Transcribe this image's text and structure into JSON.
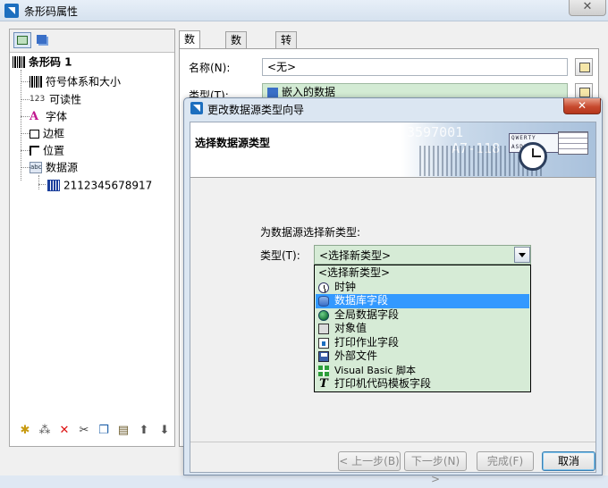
{
  "outer_window": {
    "title": "条形码属性",
    "close_glyph": "✕"
  },
  "tree": {
    "root_label": "条形码 1",
    "items": [
      {
        "label": "符号体系和大小",
        "icon": "barcode-icon"
      },
      {
        "label": "可读性",
        "icon": "readability-123-icon",
        "icon_text": "123"
      },
      {
        "label": "字体",
        "icon": "font-icon",
        "icon_text": "A"
      },
      {
        "label": "边框",
        "icon": "border-icon"
      },
      {
        "label": "位置",
        "icon": "position-icon"
      },
      {
        "label": "数据源",
        "icon": "datasource-icon",
        "icon_text": "abc"
      }
    ],
    "child_label": "2112345678917"
  },
  "bottom_toolbar": {
    "icons": [
      "new-icon",
      "wand-icon",
      "delete-icon",
      "cut-icon",
      "copy-icon",
      "paste-icon",
      "move-up-icon",
      "move-down-icon"
    ]
  },
  "tabs": [
    "数据源",
    "数据类型",
    "转换"
  ],
  "form": {
    "name_label": "名称(N):",
    "name_value": "<无>",
    "type_label": "类型(T):",
    "type_value": "嵌入的数据"
  },
  "wizard": {
    "title": "更改数据源类型向导",
    "close_glyph": "✕",
    "header_title": "选择数据源类型",
    "banner_numbers": [
      "3597001",
      "A7-118"
    ],
    "prompt": "为数据源选择新类型:",
    "type_label": "类型(T):",
    "combo_value": "<选择新类型>",
    "options": [
      {
        "label": "<选择新类型>",
        "icon": ""
      },
      {
        "label": "时钟",
        "icon": "clock-icon"
      },
      {
        "label": "数据库字段",
        "icon": "database-icon",
        "selected": true
      },
      {
        "label": "全局数据字段",
        "icon": "globe-icon"
      },
      {
        "label": "对象值",
        "icon": "object-value-icon"
      },
      {
        "label": "打印作业字段",
        "icon": "print-job-icon"
      },
      {
        "label": "外部文件",
        "icon": "disk-icon"
      },
      {
        "label": "Visual Basic 脚本",
        "icon": "vb-script-icon"
      },
      {
        "label": "打印机代码模板字段",
        "icon": "printer-code-template-icon"
      }
    ],
    "buttons": {
      "back": "< 上一步(B)",
      "next": "下一步(N) >",
      "finish": "完成(F)",
      "cancel": "取消"
    }
  }
}
